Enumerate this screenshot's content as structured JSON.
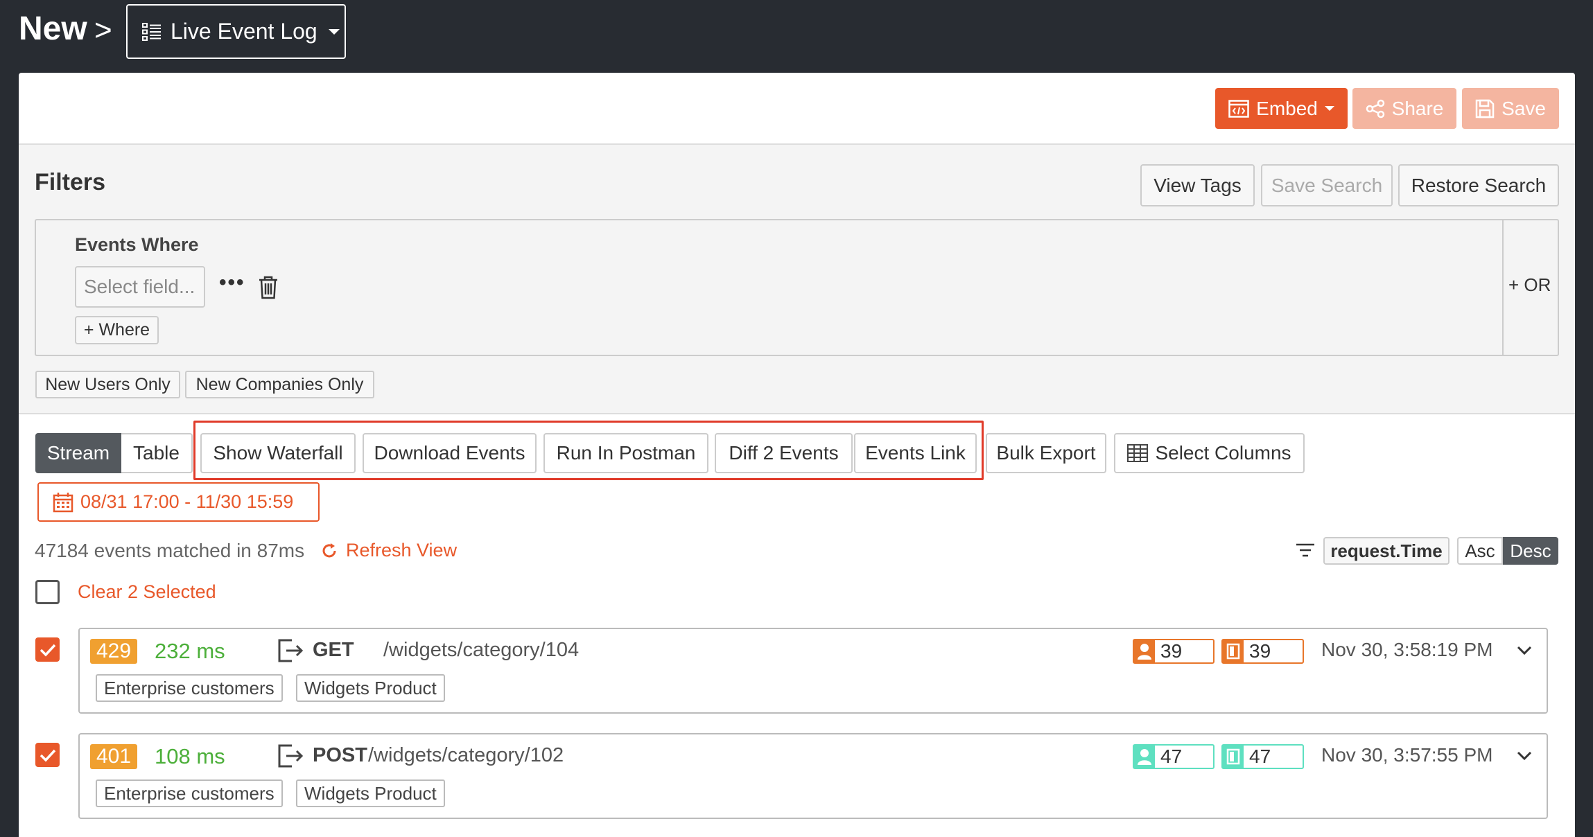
{
  "header": {
    "breadcrumb_root": "New",
    "breadcrumb_sep": ">",
    "view_label": "Live Event Log"
  },
  "actions": {
    "embed": "Embed",
    "share": "Share",
    "save": "Save"
  },
  "filters": {
    "title": "Filters",
    "view_tags": "View Tags",
    "save_search": "Save Search",
    "restore_search": "Restore Search",
    "events_where": "Events Where",
    "select_field_placeholder": "Select field...",
    "more": "•••",
    "add_where": "+ Where",
    "add_or": "+ OR",
    "new_users_only": "New Users Only",
    "new_companies_only": "New Companies Only"
  },
  "toolbar": {
    "stream": "Stream",
    "table": "Table",
    "show_waterfall": "Show Waterfall",
    "download_events": "Download Events",
    "run_in_postman": "Run In Postman",
    "diff_events": "Diff 2 Events",
    "events_link": "Events Link",
    "bulk_export": "Bulk Export",
    "select_columns": "Select Columns"
  },
  "date_range": "08/31 17:00 - 11/30 15:59",
  "results": {
    "matched": "47184 events matched in 87ms",
    "refresh": "Refresh View",
    "sort_field": "request.Time",
    "asc": "Asc",
    "desc": "Desc",
    "clear_selected": "Clear 2 Selected"
  },
  "events": [
    {
      "status": "429",
      "latency": "232 ms",
      "method": "GET",
      "path": "/widgets/category/104",
      "user_count": "39",
      "company_count": "39",
      "counter_color": "#e8762a",
      "timestamp": "Nov 30, 3:58:19 PM",
      "tags": [
        "Enterprise customers",
        "Widgets Product"
      ],
      "checked": true
    },
    {
      "status": "401",
      "latency": "108 ms",
      "method": "POST",
      "path": "/widgets/category/102",
      "user_count": "47",
      "company_count": "47",
      "counter_color": "#5ee0c0",
      "timestamp": "Nov 30, 3:57:55 PM",
      "tags": [
        "Enterprise customers",
        "Widgets Product"
      ],
      "checked": true
    }
  ],
  "colors": {
    "accent": "#e8582a",
    "accent_light": "#f4b5a0",
    "status_badge": "#f0a030",
    "latency": "#4caf3a",
    "dark_bg": "#282c32",
    "highlight": "#e03b2a"
  }
}
